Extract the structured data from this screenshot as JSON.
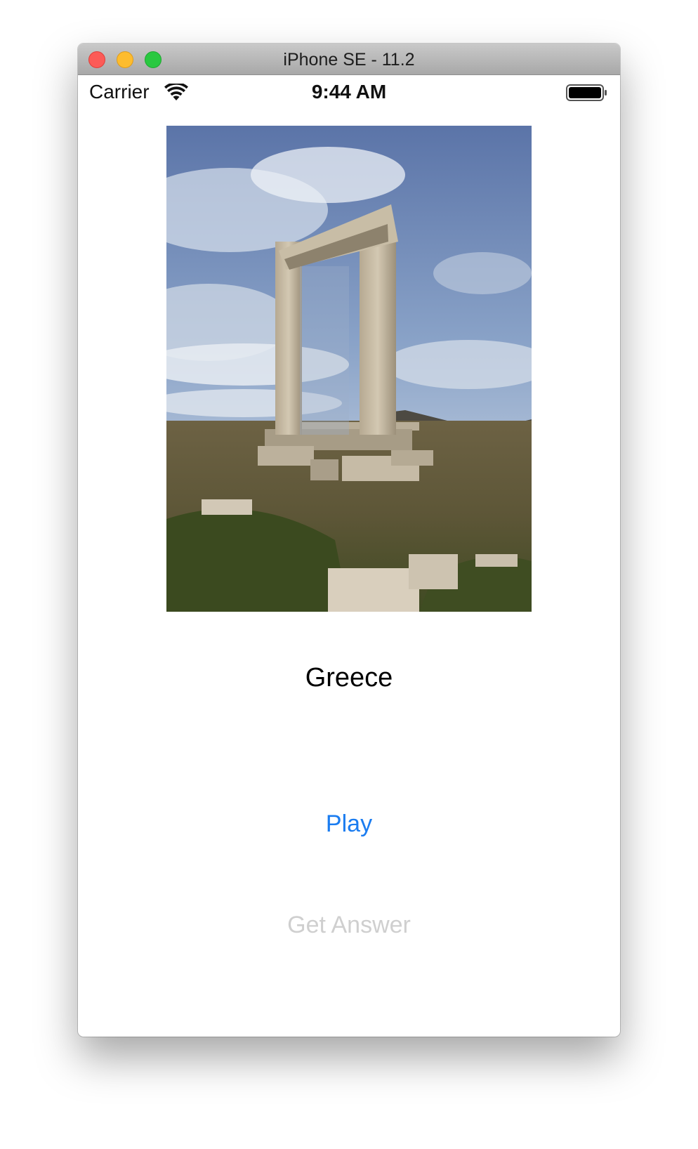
{
  "window": {
    "title": "iPhone SE - 11.2"
  },
  "status_bar": {
    "carrier": "Carrier",
    "time": "9:44 AM",
    "icons": [
      "wifi-icon",
      "battery-icon"
    ]
  },
  "main": {
    "photo_subject": "ancient stone gate ruin under cloudy sky",
    "country_label": "Greece",
    "play_button": "Play",
    "answer_button": "Get Answer"
  },
  "colors": {
    "accent": "#1a7cf0",
    "disabled": "#cfcfcf",
    "close": "#fc5b57",
    "minimize": "#fdbc2e",
    "maximize": "#29c840"
  }
}
